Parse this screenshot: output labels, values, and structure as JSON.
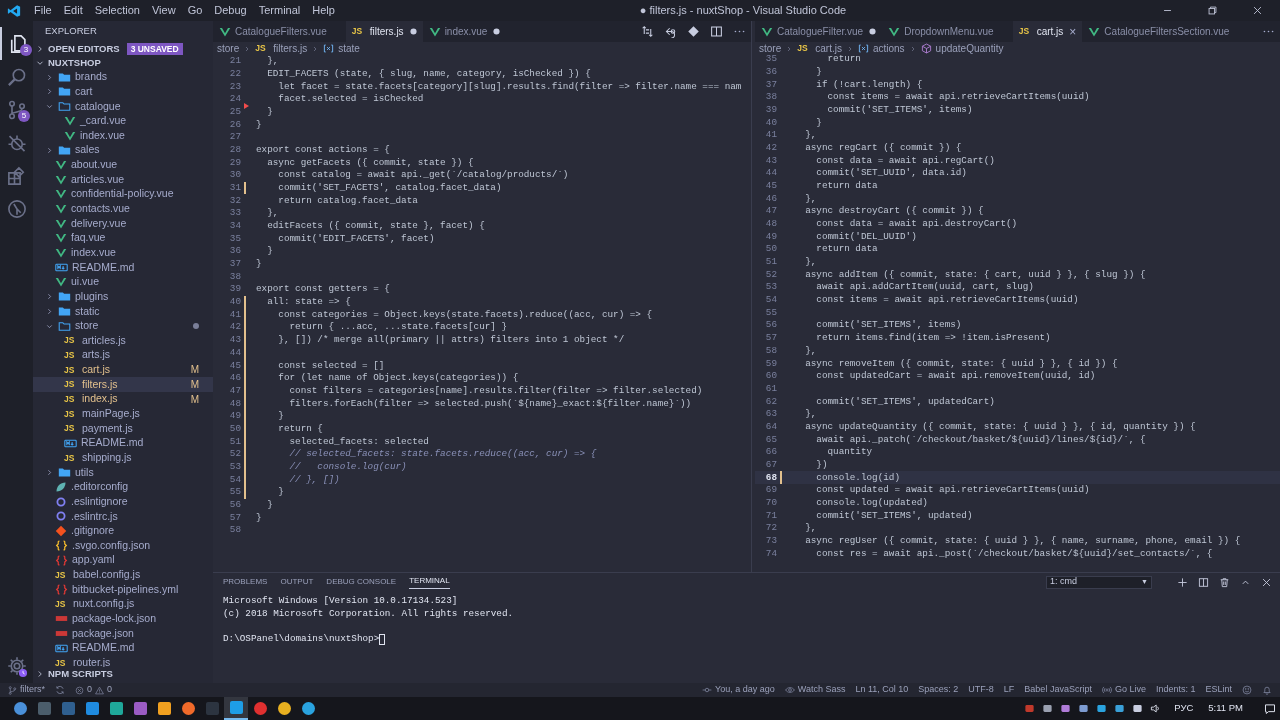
{
  "title_bar": {
    "menu": [
      "File",
      "Edit",
      "Selection",
      "View",
      "Go",
      "Debug",
      "Terminal",
      "Help"
    ],
    "title": "● filters.js - nuxtShop - Visual Studio Code"
  },
  "activity_bar": {
    "items": [
      {
        "kind": "files",
        "badge": "3",
        "selected": true
      },
      {
        "kind": "search",
        "selected": false
      },
      {
        "kind": "source_control",
        "badge": "5",
        "selected": false
      },
      {
        "kind": "debug",
        "selected": false
      },
      {
        "kind": "extensions",
        "selected": false
      },
      {
        "kind": "remote",
        "selected": false
      }
    ]
  },
  "explorer": {
    "title": "EXPLORER",
    "open_editors": {
      "label": "OPEN EDITORS",
      "badge": "3 UNSAVED",
      "expanded": false
    },
    "root": {
      "label": "NUXTSHOP",
      "expanded": true
    },
    "tree": [
      {
        "label": "brands",
        "kind": "folder",
        "expanded": false,
        "selected": false
      },
      {
        "label": "cart",
        "kind": "folder",
        "expanded": false,
        "selected": false
      },
      {
        "label": "catalogue",
        "kind": "folder",
        "expanded": true,
        "selected": false,
        "children": [
          {
            "label": "_card.vue",
            "kind": "vue",
            "selected": false
          },
          {
            "label": "index.vue",
            "kind": "vue",
            "selected": false
          }
        ]
      },
      {
        "label": "sales",
        "kind": "folder",
        "expanded": false,
        "selected": false
      },
      {
        "label": "about.vue",
        "kind": "vue",
        "selected": false
      },
      {
        "label": "articles.vue",
        "kind": "vue",
        "selected": false
      },
      {
        "label": "confidential-policy.vue",
        "kind": "vue",
        "selected": false
      },
      {
        "label": "contacts.vue",
        "kind": "vue",
        "selected": false
      },
      {
        "label": "delivery.vue",
        "kind": "vue",
        "selected": false
      },
      {
        "label": "faq.vue",
        "kind": "vue",
        "selected": false
      },
      {
        "label": "index.vue",
        "kind": "vue",
        "selected": false
      },
      {
        "label": "README.md",
        "kind": "md",
        "selected": false
      },
      {
        "label": "ui.vue",
        "kind": "vue",
        "selected": false
      },
      {
        "label": "plugins",
        "kind": "folder",
        "expanded": false,
        "selected": false
      },
      {
        "label": "static",
        "kind": "folder",
        "expanded": false,
        "selected": false
      },
      {
        "label": "store",
        "kind": "folder",
        "expanded": true,
        "selected": false,
        "changed_dot": true,
        "children": [
          {
            "label": "articles.js",
            "kind": "js",
            "icon_text": "JS",
            "selected": false
          },
          {
            "label": "arts.js",
            "kind": "js",
            "icon_text": "JS",
            "selected": false
          },
          {
            "label": "cart.js",
            "kind": "js",
            "icon_text": "JS",
            "badge": "M",
            "selected": false
          },
          {
            "label": "filters.js",
            "kind": "js",
            "icon_text": "JS",
            "badge": "M",
            "selected": true
          },
          {
            "label": "index.js",
            "kind": "js",
            "icon_text": "JS",
            "badge": "M",
            "selected": false
          },
          {
            "label": "mainPage.js",
            "kind": "js",
            "icon_text": "JS",
            "selected": false
          },
          {
            "label": "payment.js",
            "kind": "js",
            "icon_text": "JS",
            "selected": false
          },
          {
            "label": "README.md",
            "kind": "md",
            "selected": false
          },
          {
            "label": "shipping.js",
            "kind": "js",
            "icon_text": "JS",
            "selected": false
          }
        ]
      },
      {
        "label": "utils",
        "kind": "folder",
        "expanded": false,
        "selected": false
      },
      {
        "label": ".editorconfig",
        "kind": "editorconfig",
        "selected": false
      },
      {
        "label": ".eslintignore",
        "kind": "eslint",
        "selected": false
      },
      {
        "label": ".eslintrc.js",
        "kind": "eslint",
        "selected": false
      },
      {
        "label": ".gitignore",
        "kind": "git",
        "selected": false
      },
      {
        "label": ".svgo.config.json",
        "kind": "json",
        "selected": false
      },
      {
        "label": "app.yaml",
        "kind": "yaml",
        "selected": false
      },
      {
        "label": "babel.config.js",
        "kind": "js",
        "icon_text": "JS",
        "selected": false
      },
      {
        "label": "bitbucket-pipelines.yml",
        "kind": "yaml",
        "selected": false
      },
      {
        "label": "nuxt.config.js",
        "kind": "js",
        "icon_text": "JS",
        "selected": false
      },
      {
        "label": "package-lock.json",
        "kind": "npm",
        "selected": false
      },
      {
        "label": "package.json",
        "kind": "npm",
        "selected": false
      },
      {
        "label": "README.md",
        "kind": "md",
        "selected": false
      },
      {
        "label": "router.js",
        "kind": "js",
        "icon_text": "JS",
        "selected": false
      }
    ],
    "npm_scripts": {
      "label": "NPM SCRIPTS",
      "expanded": false
    }
  },
  "editor_groups": [
    {
      "tabs": [
        {
          "label": "CatalogueFilters.vue",
          "kind": "vue",
          "selected": false,
          "dirty": false
        },
        {
          "label": "filters.js",
          "kind": "js",
          "icon_text": "JS",
          "selected": true,
          "dirty": true
        },
        {
          "label": "index.vue",
          "kind": "vue",
          "selected": false,
          "dirty": true
        }
      ],
      "toolbar": [
        {
          "kind": "compare"
        },
        {
          "kind": "back"
        },
        {
          "kind": "git"
        },
        {
          "kind": "split"
        },
        {
          "kind": "more"
        }
      ],
      "breadcrumbs": [
        {
          "kind": "folder",
          "text": "store"
        },
        {
          "kind": "js",
          "icon_text": "JS",
          "text": "filters.js"
        },
        {
          "kind": "variable",
          "text": "state"
        }
      ],
      "lines": [
        {
          "n": "21",
          "text": "  },"
        },
        {
          "n": "22",
          "text": "  EDIT_FACETS (state, { slug, name, category, isChecked }) {"
        },
        {
          "n": "23",
          "text": "    let facet = state.facets[category][slug].results.find(filter => filter.name === nam"
        },
        {
          "n": "24",
          "text": "    facet.selected = isChecked",
          "deleted": true
        },
        {
          "n": "25",
          "text": "  }"
        },
        {
          "n": "26",
          "text": "}"
        },
        {
          "n": "27"
        },
        {
          "n": "28",
          "text": "export const actions = {"
        },
        {
          "n": "29",
          "text": "  async getFacets ({ commit, state }) {"
        },
        {
          "n": "30",
          "text": "    const catalog = await api._get(`/catalog/products/`)"
        },
        {
          "n": "31",
          "text": "    commit('SET_FACETS', catalog.facet_data)",
          "modified": true
        },
        {
          "n": "32",
          "text": "    return catalog.facet_data"
        },
        {
          "n": "33",
          "text": "  },"
        },
        {
          "n": "34",
          "text": "  editFacets ({ commit, state }, facet) {"
        },
        {
          "n": "35",
          "text": "    commit('EDIT_FACETS', facet)"
        },
        {
          "n": "36",
          "text": "  }"
        },
        {
          "n": "37",
          "text": "}"
        },
        {
          "n": "38"
        },
        {
          "n": "39",
          "text": "export const getters = {"
        },
        {
          "n": "40",
          "text": "  all: state => {",
          "modified": true
        },
        {
          "n": "41",
          "text": "    const categories = Object.keys(state.facets).reduce((acc, cur) => {",
          "modified": true
        },
        {
          "n": "42",
          "text": "      return { ...acc, ...state.facets[cur] }",
          "modified": true
        },
        {
          "n": "43",
          "text": "    }, []) /* merge all(primary || attrs) filters into 1 object */",
          "modified": true
        },
        {
          "n": "44",
          "modified": true
        },
        {
          "n": "45",
          "text": "    const selected = []",
          "modified": true
        },
        {
          "n": "46",
          "text": "    for (let name of Object.keys(categories)) {",
          "modified": true
        },
        {
          "n": "47",
          "text": "      const filters = categories[name].results.filter(filter => filter.selected)",
          "modified": true
        },
        {
          "n": "48",
          "text": "      filters.forEach(filter => selected.push(`${name}_exact:${filter.name}`))",
          "modified": true
        },
        {
          "n": "49",
          "text": "    }",
          "modified": true
        },
        {
          "n": "50",
          "text": "    return {",
          "modified": true
        },
        {
          "n": "51",
          "text": "      selected_facets: selected",
          "modified": true
        },
        {
          "n": "52",
          "text": "      // selected_facets: state.facets.reduce((acc, cur) => {",
          "kind": "comment",
          "modified": true
        },
        {
          "n": "53",
          "text": "      //   console.log(cur)",
          "kind": "comment",
          "modified": true
        },
        {
          "n": "54",
          "text": "      // }, [])",
          "kind": "comment",
          "modified": true
        },
        {
          "n": "55",
          "text": "    }",
          "modified": true
        },
        {
          "n": "56",
          "text": "  }"
        },
        {
          "n": "57",
          "text": "}"
        },
        {
          "n": "58"
        }
      ]
    },
    {
      "tabs": [
        {
          "label": "CatalogueFilter.vue",
          "kind": "vue",
          "selected": false,
          "dirty": true
        },
        {
          "label": "DropdownMenu.vue",
          "kind": "vue",
          "selected": false,
          "dirty": false
        },
        {
          "label": "cart.js",
          "kind": "js",
          "icon_text": "JS",
          "selected": true,
          "dirty": false,
          "close": "×"
        },
        {
          "label": "CatalogueFiltersSection.vue",
          "kind": "vue",
          "selected": false,
          "dirty": false
        }
      ],
      "toolbar": [
        {
          "kind": "more"
        }
      ],
      "breadcrumbs": [
        {
          "kind": "folder",
          "text": "store"
        },
        {
          "kind": "js",
          "icon_text": "JS",
          "text": "cart.js"
        },
        {
          "kind": "variable",
          "text": "actions"
        },
        {
          "kind": "method",
          "text": "updateQuantity"
        }
      ],
      "lines": [
        {
          "n": "35",
          "text": "      return"
        },
        {
          "n": "36",
          "text": "    }"
        },
        {
          "n": "37",
          "text": "    if (!cart.length) {"
        },
        {
          "n": "38",
          "text": "      const items = await api.retrieveCartItems(uuid)"
        },
        {
          "n": "39",
          "text": "      commit('SET_ITEMS', items)"
        },
        {
          "n": "40",
          "text": "    }"
        },
        {
          "n": "41",
          "text": "  },"
        },
        {
          "n": "42",
          "text": "  async regCart ({ commit }) {"
        },
        {
          "n": "43",
          "text": "    const data = await api.regCart()"
        },
        {
          "n": "44",
          "text": "    commit('SET_UUID', data.id)"
        },
        {
          "n": "45",
          "text": "    return data"
        },
        {
          "n": "46",
          "text": "  },"
        },
        {
          "n": "47",
          "text": "  async destroyCart ({ commit }) {"
        },
        {
          "n": "48",
          "text": "    const data = await api.destroyCart()"
        },
        {
          "n": "49",
          "text": "    commit('DEL_UUID')"
        },
        {
          "n": "50",
          "text": "    return data"
        },
        {
          "n": "51",
          "text": "  },"
        },
        {
          "n": "52",
          "text": "  async addItem ({ commit, state: { cart, uuid } }, { slug }) {"
        },
        {
          "n": "53",
          "text": "    await api.addCartItem(uuid, cart, slug)"
        },
        {
          "n": "54",
          "text": "    const items = await api.retrieveCartItems(uuid)"
        },
        {
          "n": "55"
        },
        {
          "n": "56",
          "text": "    commit('SET_ITEMS', items)"
        },
        {
          "n": "57",
          "text": "    return items.find(item => !item.isPresent)"
        },
        {
          "n": "58",
          "text": "  },"
        },
        {
          "n": "59",
          "text": "  async removeItem ({ commit, state: { uuid } }, { id }) {"
        },
        {
          "n": "60",
          "text": "    const updatedCart = await api.removeItem(uuid, id)"
        },
        {
          "n": "61"
        },
        {
          "n": "62",
          "text": "    commit('SET_ITEMS', updatedCart)"
        },
        {
          "n": "63",
          "text": "  },"
        },
        {
          "n": "64",
          "text": "  async updateQuantity ({ commit, state: { uuid } }, { id, quantity }) {"
        },
        {
          "n": "65",
          "text": "    await api._patch(`/checkout/basket/${uuid}/lines/${id}/`, {"
        },
        {
          "n": "66",
          "text": "      quantity"
        },
        {
          "n": "67",
          "text": "    })"
        },
        {
          "n": "68",
          "text": "    console.log(id)",
          "modified": true,
          "current": true
        },
        {
          "n": "69",
          "text": "    const updated = await api.retrieveCartItems(uuid)"
        },
        {
          "n": "70",
          "text": "    console.log(updated)"
        },
        {
          "n": "71",
          "text": "    commit('SET_ITEMS', updated)"
        },
        {
          "n": "72",
          "text": "  },"
        },
        {
          "n": "73",
          "text": "  async regUser ({ commit, state: { uuid } }, { name, surname, phone, email }) {"
        },
        {
          "n": "74",
          "text": "    const res = await api._post(`/checkout/basket/${uuid}/set_contacts/`, {"
        }
      ]
    }
  ],
  "panel": {
    "tabs": [
      {
        "label": "PROBLEMS",
        "selected": false
      },
      {
        "label": "OUTPUT",
        "selected": false
      },
      {
        "label": "DEBUG CONSOLE",
        "selected": false
      },
      {
        "label": "TERMINAL",
        "selected": true
      }
    ],
    "terminal_select": {
      "value": "1: cmd",
      "caret": "▼"
    },
    "actions": [
      {
        "kind": "add"
      },
      {
        "kind": "split"
      },
      {
        "kind": "trash"
      },
      {
        "kind": "maximize"
      },
      {
        "kind": "close"
      }
    ],
    "terminal_lines": [
      "Microsoft Windows [Version 10.0.17134.523]",
      "(c) 2018 Microsoft Corporation. All rights reserved."
    ],
    "prompt": "D:\\OSPanel\\domains\\nuxtShop>"
  },
  "status_bar": {
    "branch": "filters*",
    "errors": "0",
    "warnings": "0",
    "items": [
      {
        "kind": "blame",
        "text": "You, a day ago"
      },
      {
        "kind": "watch",
        "text": "Watch Sass"
      },
      {
        "kind": "plain",
        "text": "Ln 11, Col 10"
      },
      {
        "kind": "plain",
        "text": "Spaces: 2"
      },
      {
        "kind": "plain",
        "text": "UTF-8"
      },
      {
        "kind": "plain",
        "text": "LF"
      },
      {
        "kind": "plain",
        "text": "Babel JavaScript"
      },
      {
        "kind": "live",
        "text": "Go Live"
      },
      {
        "kind": "plain",
        "text": "Indents: 1"
      },
      {
        "kind": "plain",
        "text": "ESLint"
      }
    ]
  },
  "taskbar": {
    "apps": [
      {
        "kind": "round",
        "color": "#4a90d9",
        "active": false
      },
      {
        "kind": "square",
        "color": "#4b5d6b",
        "active": false
      },
      {
        "kind": "square",
        "color": "#2f5f8f",
        "active": false
      },
      {
        "kind": "square",
        "color": "#1f8be0",
        "active": false
      },
      {
        "kind": "square",
        "color": "#1fa89a",
        "active": false
      },
      {
        "kind": "square",
        "color": "#9b5cc4",
        "active": false
      },
      {
        "kind": "square",
        "color": "#f0a020",
        "active": false
      },
      {
        "kind": "round",
        "color": "#f06a2a",
        "active": false
      },
      {
        "kind": "square",
        "color": "#2c3440",
        "active": false
      },
      {
        "kind": "square",
        "color": "#1e9de6",
        "active": true
      },
      {
        "kind": "round",
        "color": "#e03030",
        "active": false
      },
      {
        "kind": "round",
        "color": "#e8b020",
        "active": false
      },
      {
        "kind": "round",
        "color": "#2aa3df",
        "active": false
      }
    ],
    "language": "РУС",
    "time": "5:11 PM"
  }
}
